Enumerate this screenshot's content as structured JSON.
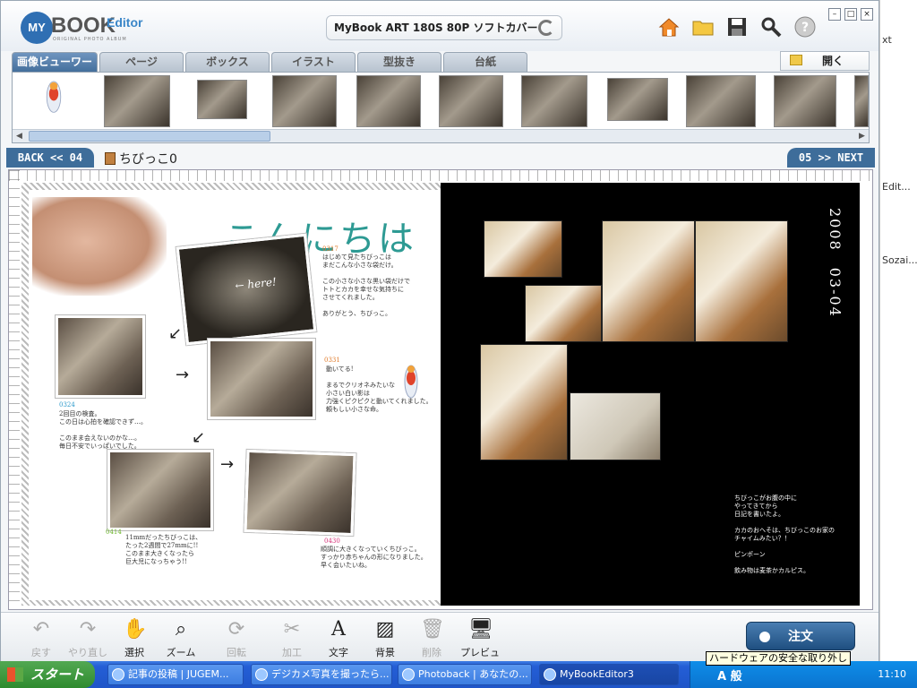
{
  "app": {
    "logo_my": "MY",
    "logo_book": "BOOK",
    "logo_editor": "Editor",
    "logo_sub": "ORIGINAL PHOTO ALBUM",
    "product_label": "MyBook ART 180S 80P ソフトカバー"
  },
  "tabs": [
    {
      "label": "画像ビューワー",
      "active": true
    },
    {
      "label": "ページ"
    },
    {
      "label": "ボックス"
    },
    {
      "label": "イラスト"
    },
    {
      "label": "型抜き"
    },
    {
      "label": "台紙"
    }
  ],
  "open_button": "開く",
  "nav": {
    "back": "BACK << 04",
    "next": "05 >> NEXT",
    "page_name": "ちびっこ0"
  },
  "left_page": {
    "title": "こんにちは",
    "photo_caption": "← here!",
    "notes": [
      {
        "date": "0317",
        "text": "はじめて見たちびっこは\nまだこんな小さな袋だけ。\n\nこの小さな小さな黒い袋だけで\nトトとカカを幸せな気持ちに\nさせてくれました。\n\nありがとう、ちびっこ。"
      },
      {
        "date": "0331",
        "text": "動いてる!\n\nまるでクリオネみたいな\n小さい白い影は\n力強くピクピクと動いてくれました。\n頼もしい小さな命。"
      },
      {
        "date": "0324",
        "text": "2回目の検査。\nこの日は心拍を確認できず…。\n\nこのまま会えないのかな…。\n毎日不安でいっぱいでした。"
      },
      {
        "date": "0414",
        "text": "11mmだったちびっこは、\nたった2週間で27mmに!!\nこのまま大きくなったら\n巨大児になっちゃう!!"
      },
      {
        "date": "0430",
        "text": "順調に大きくなっていくちびっこ。\nすっかり赤ちゃんの形になりました。\n早く会いたいね。"
      }
    ]
  },
  "right_page": {
    "date_vertical": "2008　03-04",
    "note": "ちびっこがお腹の中に\nやってきてから\n日記を書いたよ。\n\nカカのおヘそは、ちびっこのお家の\nチャイムみたい？！\n\nピンポーン\n\n飲み物は麦茶かカルピス。"
  },
  "toolbar": [
    {
      "label": "戻す",
      "icon": "undo-icon",
      "disabled": true
    },
    {
      "label": "やり直し",
      "icon": "redo-icon",
      "disabled": true
    },
    {
      "label": "選択",
      "icon": "hand-icon"
    },
    {
      "label": "ズーム",
      "icon": "magnifier-icon"
    },
    {
      "label": "回転",
      "icon": "rotate-icon",
      "disabled": true
    },
    {
      "label": "加工",
      "icon": "scissors-icon",
      "disabled": true
    },
    {
      "label": "文字",
      "icon": "text-icon"
    },
    {
      "label": "背景",
      "icon": "background-icon"
    },
    {
      "label": "削除",
      "icon": "trash-icon",
      "disabled": true
    },
    {
      "label": "プレビュー",
      "icon": "monitor-icon"
    }
  ],
  "order_button": "注文",
  "taskbar": {
    "start": "スタート",
    "tasks": [
      {
        "label": "記事の投稿 | JUGEM..."
      },
      {
        "label": "デジカメ写真を撮ったら..."
      },
      {
        "label": "Photoback | あなたの..."
      },
      {
        "label": "MyBookEditor3",
        "active": true
      }
    ],
    "ime": "A 般",
    "clock": "11:10",
    "tooltip": "ハードウェアの安全な取り外し"
  },
  "right_strip": {
    "t1": "xt",
    "t2": "Edit...",
    "t3": "Sozai..."
  },
  "colors": {
    "accent": "#3e6d9a",
    "title_teal": "#2d9a93",
    "date_orange": "#e07b2b"
  }
}
